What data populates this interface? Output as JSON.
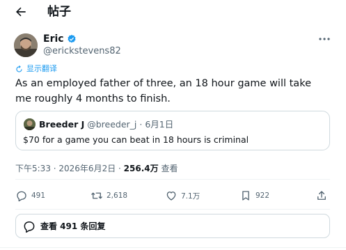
{
  "header": {
    "title": "帖子",
    "back_icon": "arrow-left-icon"
  },
  "author": {
    "name": "Eric",
    "handle": "@erickstevens82",
    "verified_icon": "verified-badge-icon",
    "verified_color": "#1d9bf0"
  },
  "post": {
    "translate_label": "显示翻译",
    "text": "As an employed father of three, an 18 hour game will take me roughly 4 months to finish."
  },
  "quote": {
    "name": "Breeder J",
    "meta": "@breeder_j · 6月1日",
    "text": "$70 for a game you can beat in 18 hours is criminal"
  },
  "meta": {
    "time_date": "下午5:33 · 2026年6月2日 · ",
    "views": "256.4万",
    "views_label": " 查看"
  },
  "actions": {
    "reply_count": "491",
    "repost_count": "2,618",
    "like_count": "7.1万",
    "bookmark_count": "922"
  },
  "replies_button": {
    "label": "查看 491 条回复"
  },
  "colors": {
    "text": "#0f1419",
    "secondary": "#536471",
    "accent": "#1d9bf0",
    "border": "#cfd9de"
  }
}
